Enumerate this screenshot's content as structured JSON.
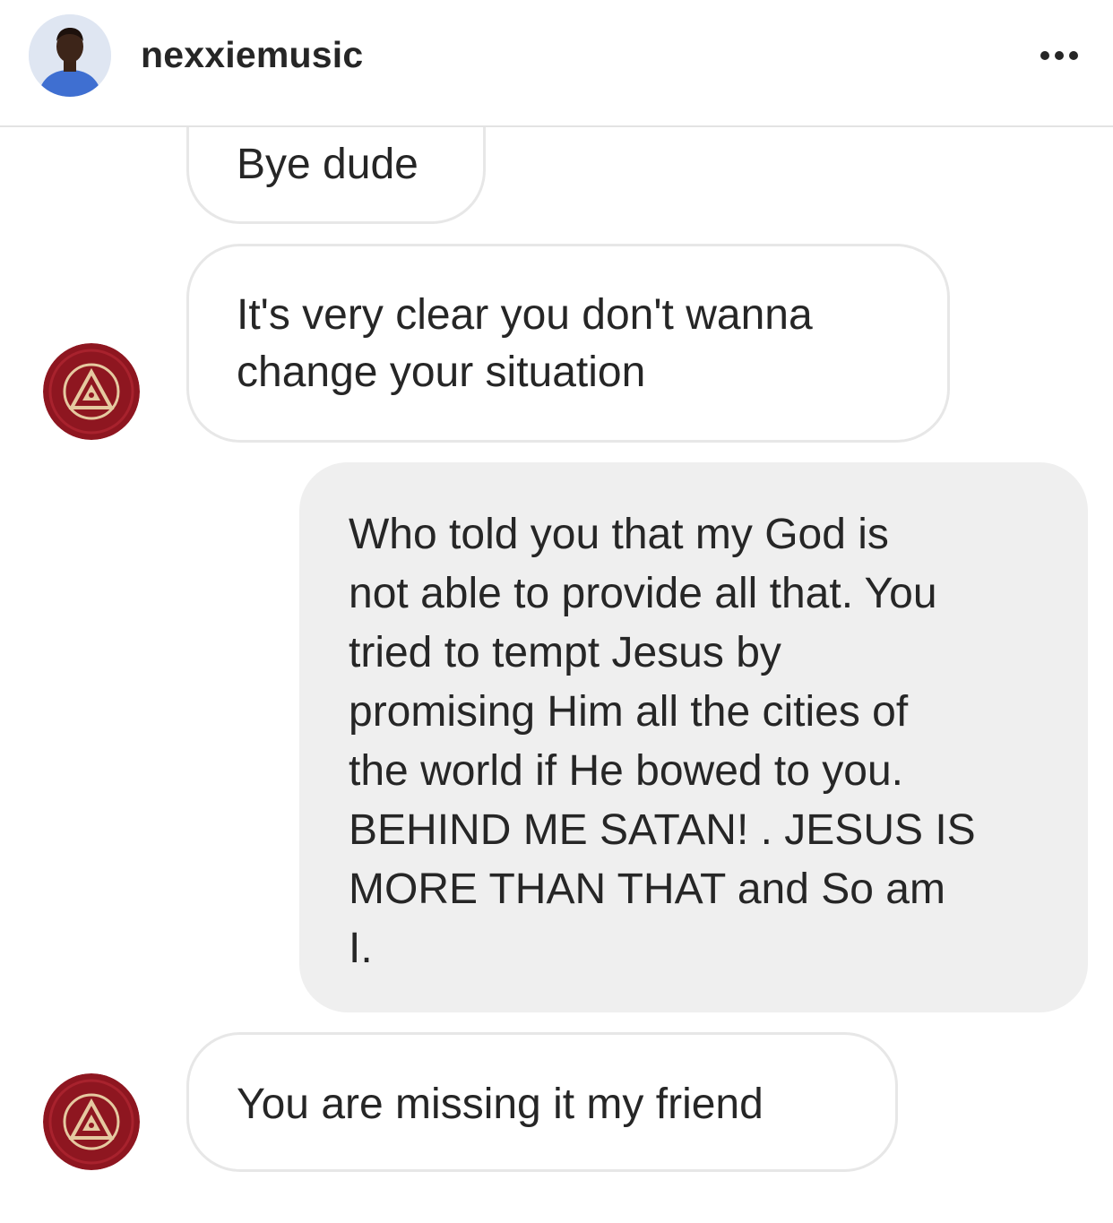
{
  "header": {
    "username": "nexxiemusic",
    "avatar_icon": "profile-photo",
    "more_icon": "more-horizontal-icon"
  },
  "conversation": {
    "sender_avatar_icon": "illuminati-pyramid-logo",
    "colors": {
      "incoming_bubble_bg": "#ffffff",
      "incoming_bubble_border": "#e7e7e7",
      "outgoing_bubble_bg": "#efefef",
      "text": "#262626",
      "sender_avatar_bg": "#8e1620"
    },
    "messages": [
      {
        "direction": "incoming",
        "text": "Bye dude"
      },
      {
        "direction": "incoming",
        "text": "It's very clear you don't wanna\nchange your situation"
      },
      {
        "direction": "outgoing",
        "text": "Who told you that my God is\nnot able to provide all that. You\ntried to tempt Jesus by\npromising Him all the cities of\nthe world if He bowed to you.\nBEHIND ME SATAN! . JESUS IS\nMORE THAN THAT and So am\nI."
      },
      {
        "direction": "incoming",
        "text": "You are missing it my friend"
      }
    ]
  }
}
